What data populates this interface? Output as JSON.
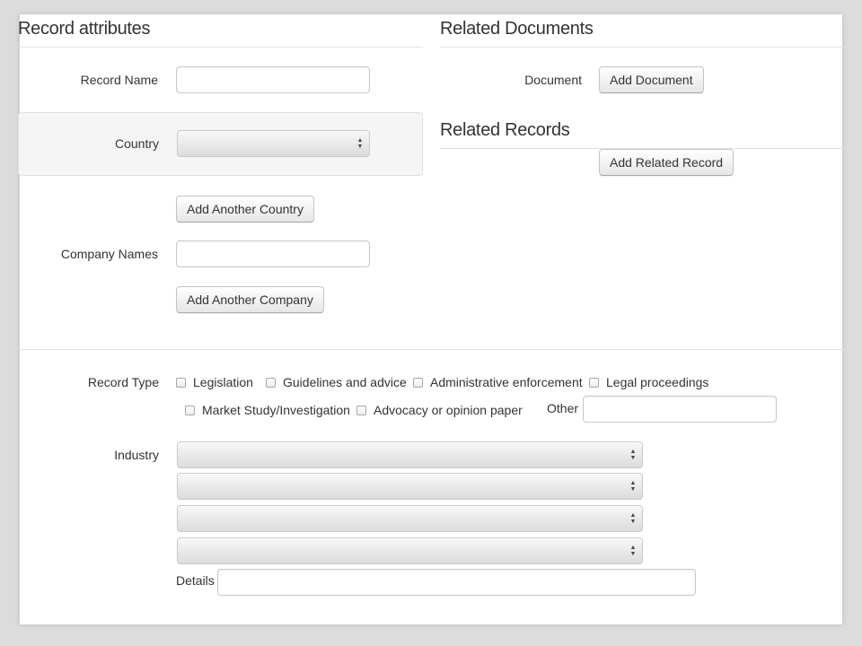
{
  "record_attributes": {
    "title": "Record attributes",
    "record_name": {
      "label": "Record Name",
      "value": ""
    },
    "country": {
      "label": "Country",
      "selected": ""
    },
    "add_country_label": "Add Another Country",
    "company_names": {
      "label": "Company Names",
      "value": ""
    },
    "add_company_label": "Add Another Company"
  },
  "related_documents": {
    "title": "Related Documents",
    "document_label": "Document",
    "add_document_label": "Add Document"
  },
  "related_records": {
    "title": "Related Records",
    "add_related_label": "Add Related Record"
  },
  "record_type": {
    "label": "Record Type",
    "options": [
      "Legislation",
      "Guidelines and advice",
      "Administrative enforcement",
      "Legal proceedings",
      "Market Study/Investigation",
      "Advocacy or opinion paper"
    ],
    "other_label": "Other",
    "other_value": ""
  },
  "industry": {
    "label": "Industry",
    "selects": [
      "",
      "",
      "",
      ""
    ],
    "details_label": "Details",
    "details_value": ""
  },
  "icons": {
    "select_arrows": "up-down-chevron-icon"
  },
  "colors": {
    "page_background": "#dcdcdc",
    "panel_background": "#ffffff",
    "well_background": "#f5f5f5",
    "text": "#333333",
    "divider": "#e2e2e2"
  }
}
